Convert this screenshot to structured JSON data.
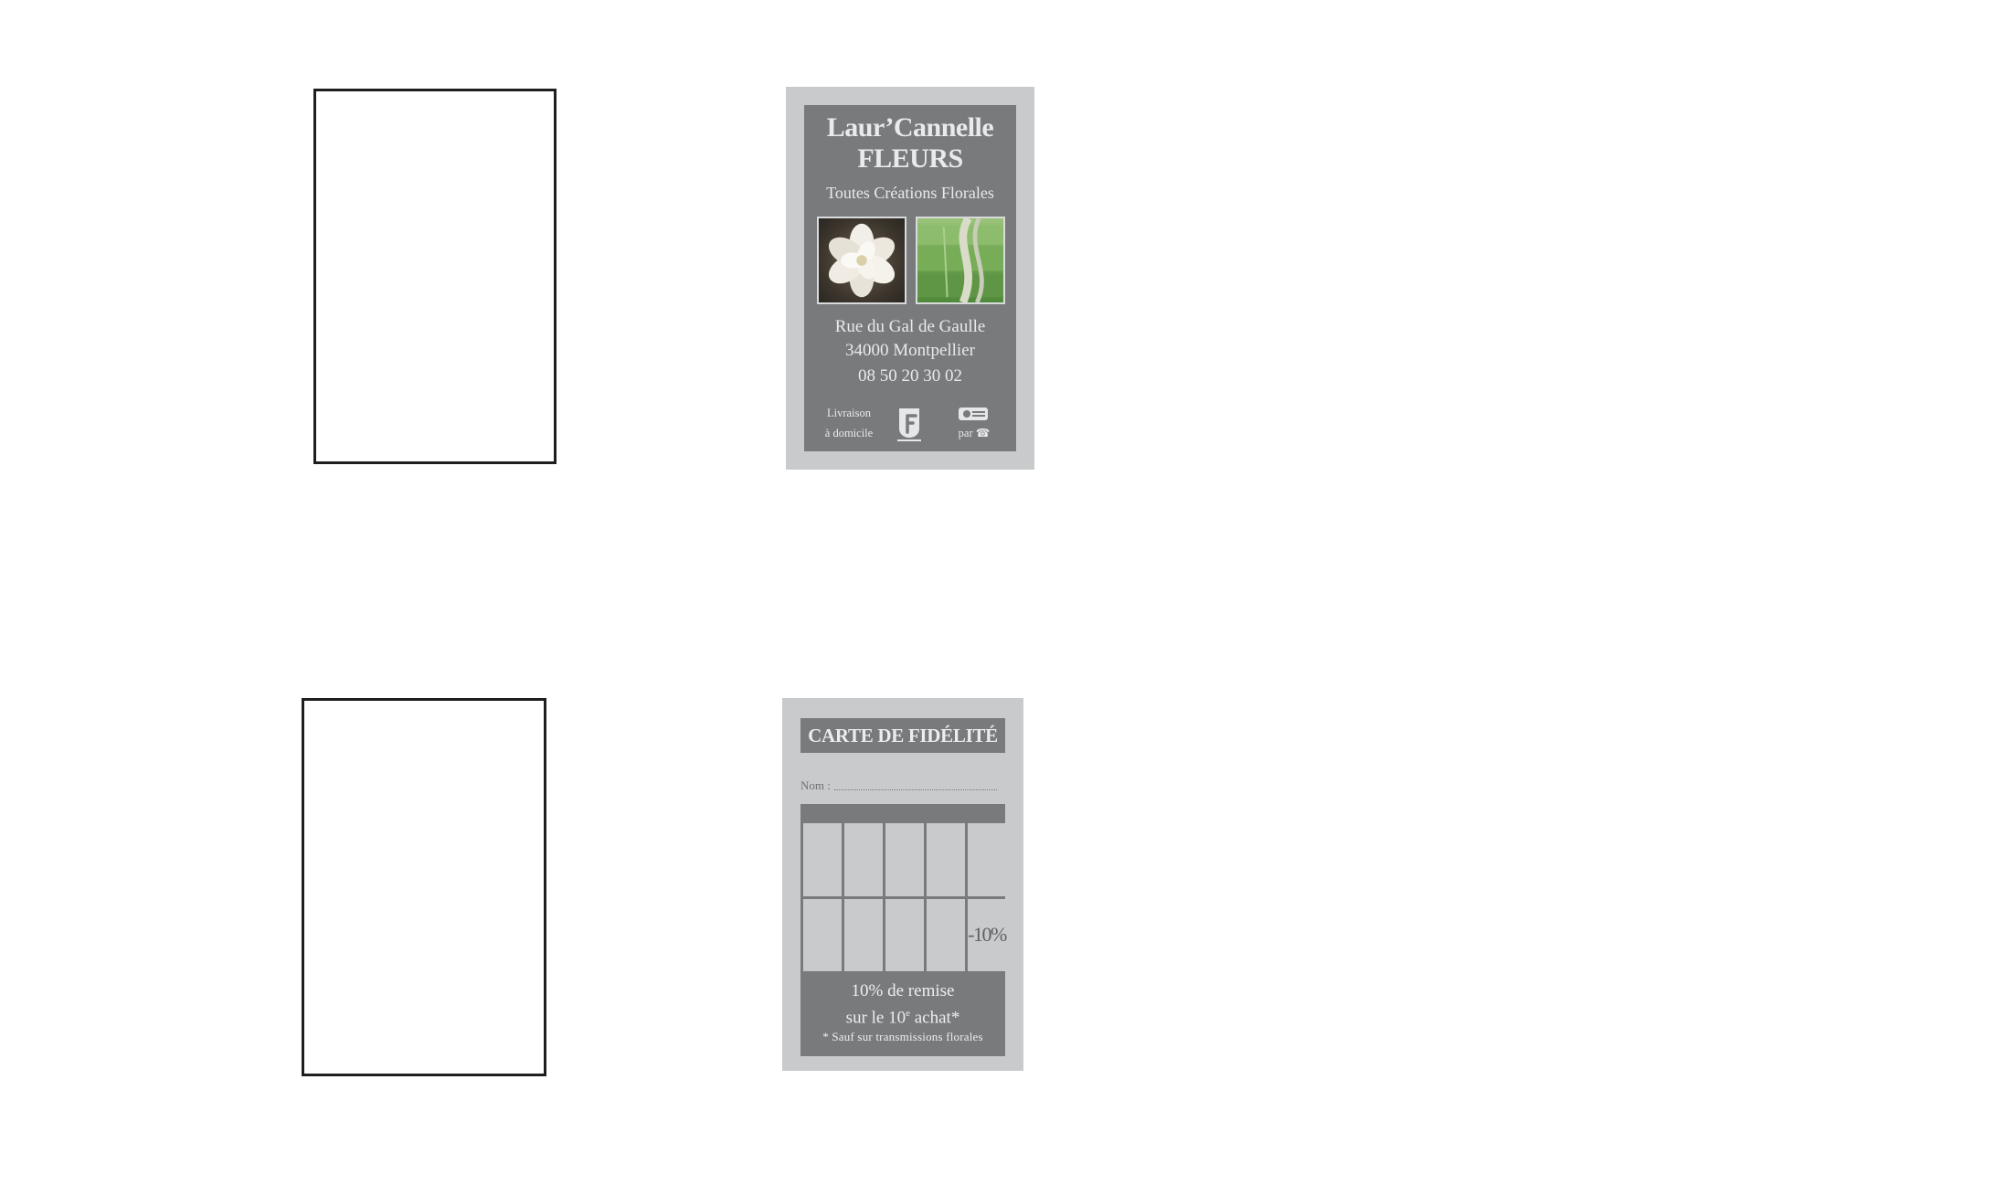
{
  "business_card": {
    "name_line1": "Laur’Cannelle",
    "name_line2": "FLEURS",
    "tagline": "Toutes Créations Florales",
    "address_street": "Rue du Gal de Gaulle",
    "address_city": "34000 Montpellier",
    "phone": "08 50 20 30 02",
    "delivery_line1": "Livraison",
    "delivery_line2": "à domicile",
    "phone_order_prefix": "par",
    "phone_order_symbol": "☎",
    "icons": [
      "flower-photo",
      "bamboo-photo",
      "florist-logo-icon",
      "credit-card-icon",
      "telephone-icon"
    ],
    "colors": {
      "border": "#c8cacc",
      "panel": "#787a7c",
      "text": "#e9eaeb"
    }
  },
  "loyalty_card": {
    "title": "CARTE DE FIDÉLITÉ",
    "name_label": "Nom :",
    "stamp_cells": [
      "",
      "",
      "",
      "",
      "",
      "",
      "",
      "",
      "",
      "-10%"
    ],
    "offer_line1": "10% de remise",
    "offer_line2_prefix": "sur le 10",
    "offer_line2_sup": "e",
    "offer_line2_suffix": " achat*",
    "note": "* Sauf sur transmissions florales",
    "colors": {
      "border": "#c8cacc",
      "panel": "#787a7c",
      "cell": "#c8cacc"
    }
  }
}
